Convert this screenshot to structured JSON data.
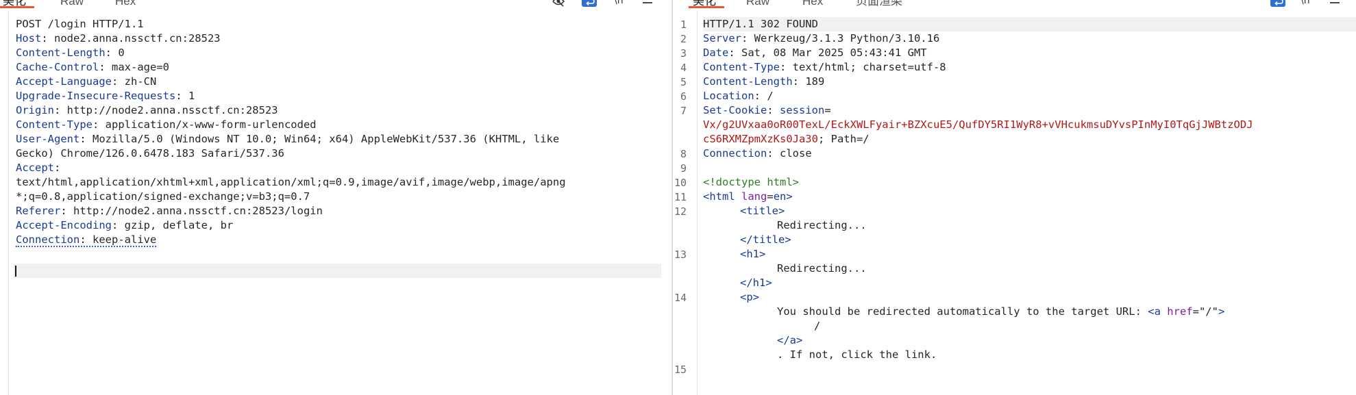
{
  "request": {
    "tabs": [
      {
        "label": "美化",
        "active": true
      },
      {
        "label": "Raw",
        "active": false
      },
      {
        "label": "Hex",
        "active": false
      }
    ],
    "toolbar_icons": [
      "eye-off-icon",
      "wrap-icon",
      "newline-icon",
      "menu-icon"
    ],
    "lines": [
      {
        "key": "",
        "value": "POST /login HTTP/1.1"
      },
      {
        "key": "Host",
        "value": "node2.anna.nssctf.cn:28523"
      },
      {
        "key": "Content-Length",
        "value": "0"
      },
      {
        "key": "Cache-Control",
        "value": "max-age=0"
      },
      {
        "key": "Accept-Language",
        "value": "zh-CN"
      },
      {
        "key": "Upgrade-Insecure-Requests",
        "value": "1"
      },
      {
        "key": "Origin",
        "value": "http://node2.anna.nssctf.cn:28523"
      },
      {
        "key": "Content-Type",
        "value": "application/x-www-form-urlencoded"
      },
      {
        "key": "User-Agent",
        "value": "Mozilla/5.0 (Windows NT 10.0; Win64; x64) AppleWebKit/537.36 (KHTML, like"
      },
      {
        "key": "",
        "value": "Gecko) Chrome/126.0.6478.183 Safari/537.36"
      },
      {
        "key": "Accept",
        "value": ""
      },
      {
        "key": "",
        "value": "text/html,application/xhtml+xml,application/xml;q=0.9,image/avif,image/webp,image/apng"
      },
      {
        "key": "",
        "value": "*;q=0.8,application/signed-exchange;v=b3;q=0.7"
      },
      {
        "key": "Referer",
        "value": "http://node2.anna.nssctf.cn:28523/login"
      },
      {
        "key": "Accept-Encoding",
        "value": "gzip, deflate, br"
      },
      {
        "key": "Connection",
        "value": "keep-alive"
      }
    ]
  },
  "response": {
    "tabs": [
      {
        "label": "美化",
        "active": true
      },
      {
        "label": "Raw",
        "active": false
      },
      {
        "label": "Hex",
        "active": false
      },
      {
        "label": "页面渲染",
        "active": false
      }
    ],
    "toolbar_icons": [
      "wrap-icon",
      "newline-icon",
      "menu-icon"
    ],
    "line_numbers": [
      "1",
      "2",
      "3",
      "4",
      "5",
      "6",
      "7",
      "8",
      "9",
      "10",
      "11",
      "12",
      "13",
      "14",
      "15"
    ],
    "status": "HTTP/1.1 302 FOUND",
    "headers": [
      {
        "key": "Server",
        "value": "Werkzeug/3.1.3 Python/3.10.16"
      },
      {
        "key": "Date",
        "value": "Sat, 08 Mar 2025 05:43:41 GMT"
      },
      {
        "key": "Content-Type",
        "value": "text/html; charset=utf-8"
      },
      {
        "key": "Content-Length",
        "value": "189"
      },
      {
        "key": "Location",
        "value": "/"
      }
    ],
    "cookie": {
      "key": "Set-Cookie",
      "name": "session",
      "value_part1": "Vx/g2UVxaa0oR00TexL/EckXWLFyair+BZXcuE5/QufDY5RI1WyR8+vVHcukmsuDYvsPInMyI0TqGjJWBtzODJ",
      "value_part2": "cS6RXMZpmXzKs0Ja30",
      "attributes": "; Path=/"
    },
    "connection": {
      "key": "Connection",
      "value": "close"
    },
    "html": {
      "doctype": "<!doctype html>",
      "html_open_tag": "html",
      "html_attr": "lang",
      "html_attr_value": "en",
      "title_tag": "title",
      "title_text": "Redirecting...",
      "h1_tag": "h1",
      "h1_text": "Redirecting...",
      "p_tag": "p",
      "p_text": "You should be redirected automatically to the target URL: ",
      "a_tag": "a",
      "a_attr": "href",
      "a_href": "\"/\"",
      "a_text": "/",
      "p_tail": ". If not, click the link."
    }
  }
}
